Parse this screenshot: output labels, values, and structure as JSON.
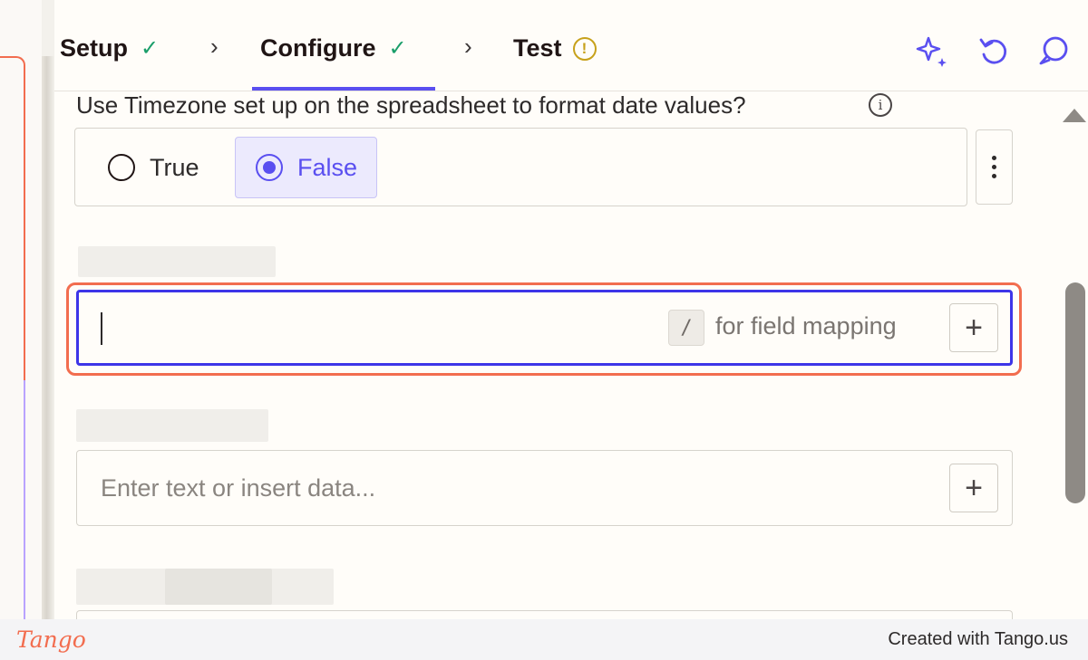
{
  "steps": [
    {
      "label": "Setup",
      "status": "complete"
    },
    {
      "label": "Configure",
      "status": "complete"
    },
    {
      "label": "Test",
      "status": "warning"
    }
  ],
  "header_icons": [
    "sparkle-icon",
    "undo-icon",
    "comment-icon"
  ],
  "timezone_question": {
    "label": "Use Timezone set up on the spreadsheet to format date values?",
    "options": [
      "True",
      "False"
    ],
    "selected": "False"
  },
  "focused_field": {
    "slash_key": "/",
    "hint": "for field mapping",
    "add_label": "+"
  },
  "text_field": {
    "placeholder": "Enter text or insert data...",
    "add_label": "+"
  },
  "colors": {
    "accent": "#5a4ff0",
    "highlight": "#f26d4f",
    "success": "#1a9e6a",
    "warning": "#c7a11b"
  },
  "footer": {
    "logo": "Tango",
    "credit": "Created with Tango.us"
  }
}
